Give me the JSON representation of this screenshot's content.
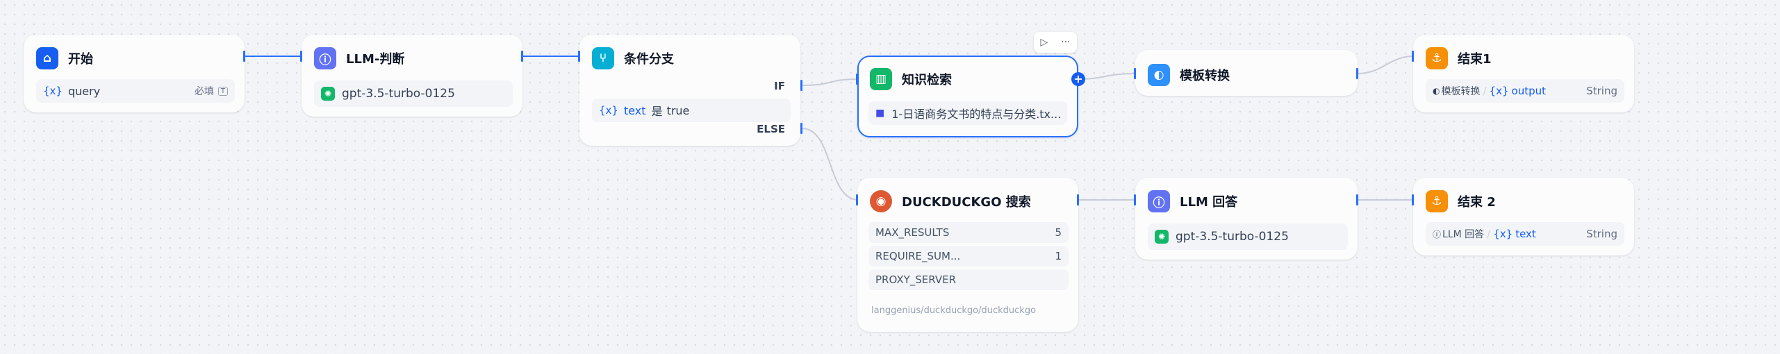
{
  "nodes": {
    "start": {
      "title": "开始",
      "var_symbol": "{x}",
      "var_name": "query",
      "required": "必填",
      "req_icon": "T"
    },
    "llm_judge": {
      "title": "LLM-判断",
      "model": "gpt-3.5-turbo-0125"
    },
    "if_else": {
      "title": "条件分支",
      "if_label": "IF",
      "else_label": "ELSE",
      "var_symbol": "{x}",
      "cond_var": "text",
      "cond_op": "是",
      "cond_value": "true"
    },
    "knowledge": {
      "title": "知识检索",
      "dataset": "1-日语商务文书的特点与分类.tx..."
    },
    "template": {
      "title": "模板转换"
    },
    "end1": {
      "title": "结束1",
      "source": "模板转换",
      "var_symbol": "{x}",
      "var_name": "output",
      "type": "String"
    },
    "duckduckgo": {
      "title": "DUCKDUCKGO 搜索",
      "params": [
        {
          "name": "MAX_RESULTS",
          "value": "5"
        },
        {
          "name": "REQUIRE_SUM...",
          "value": "1"
        },
        {
          "name": "PROXY_SERVER",
          "value": ""
        }
      ],
      "provider": "langgenius/duckduckgo/duckduckgo"
    },
    "llm_answer": {
      "title": "LLM 回答",
      "model": "gpt-3.5-turbo-0125"
    },
    "end2": {
      "title": "结束 2",
      "source": "LLM 回答",
      "var_symbol": "{x}",
      "var_name": "text",
      "type": "String"
    }
  },
  "toolbar": {
    "run_icon": "▷",
    "more_icon": "···"
  },
  "colors": {
    "accent": "#2970ff",
    "edge": "#c7ccd6",
    "start": "#155eef",
    "llm": "#6172f3",
    "ifelse": "#06aed4",
    "knowledge": "#12b76a",
    "template": "#2e90fa",
    "end": "#f79009"
  }
}
